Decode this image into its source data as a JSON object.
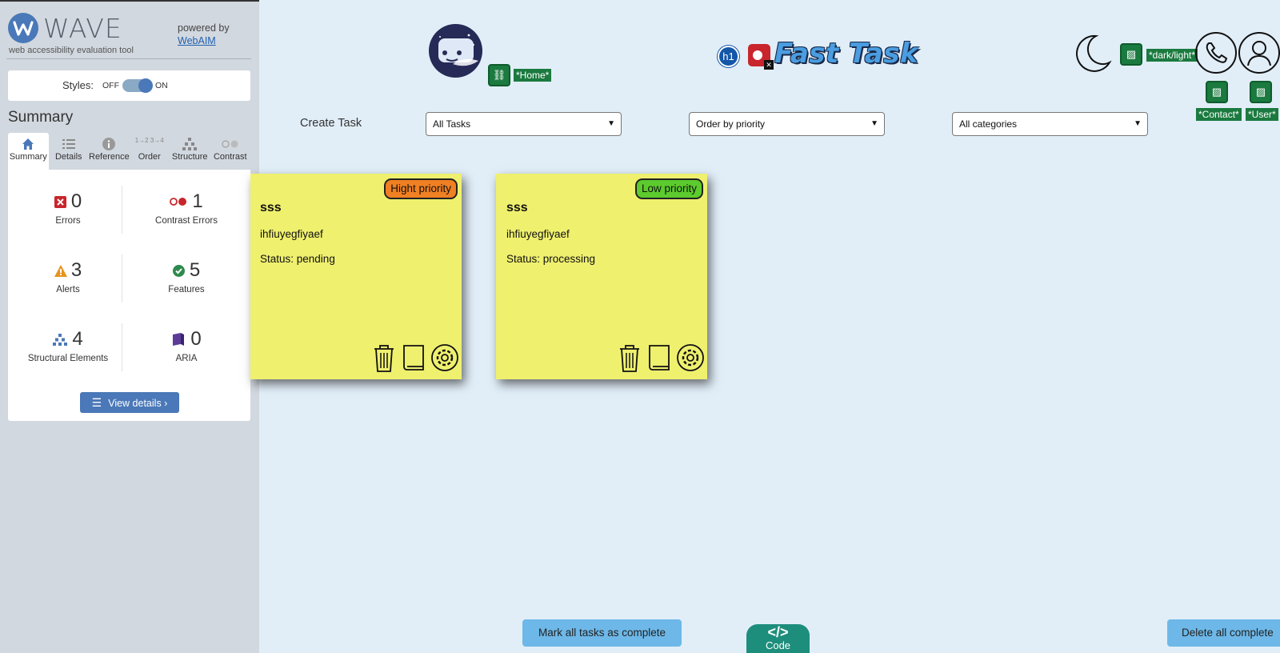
{
  "wave": {
    "brand": "WAVE",
    "subtitle": "web accessibility evaluation tool",
    "powered_by": "powered by",
    "powered_link": "WebAIM",
    "styles_label": "Styles:",
    "styles_off": "OFF",
    "styles_on": "ON",
    "summary_title": "Summary",
    "tabs": [
      {
        "label": "Summary",
        "icon": "home-icon"
      },
      {
        "label": "Details",
        "icon": "list-icon"
      },
      {
        "label": "Reference",
        "icon": "info-icon"
      },
      {
        "label": "Order",
        "icon": "order-icon"
      },
      {
        "label": "Structure",
        "icon": "structure-icon"
      },
      {
        "label": "Contrast",
        "icon": "contrast-icon"
      }
    ],
    "order_glyph": "1→2 3→4",
    "stats": {
      "errors": {
        "value": "0",
        "label": "Errors"
      },
      "contrast_errors": {
        "value": "1",
        "label": "Contrast Errors"
      },
      "alerts": {
        "value": "3",
        "label": "Alerts"
      },
      "features": {
        "value": "5",
        "label": "Features"
      },
      "structural": {
        "value": "4",
        "label": "Structural Elements"
      },
      "aria": {
        "value": "0",
        "label": "ARIA"
      }
    },
    "view_details": "View details ›"
  },
  "header": {
    "home_tag": "*Home*",
    "h1_badge": "h1",
    "app_title": "Fast Task",
    "darklight_tag": "*dark/light*",
    "contact_tag": "*Contact*",
    "user_tag": "*User*"
  },
  "toolbar": {
    "create_task": "Create Task",
    "filter_tasks": "All Tasks",
    "order": "Order by priority",
    "categories": "All categories"
  },
  "tasks": [
    {
      "priority": "Hight priority",
      "priority_color": "#f08022",
      "title": "sss",
      "description": "ihfiuyegfiyaef",
      "status": "Status: pending"
    },
    {
      "priority": "Low priority",
      "priority_color": "#5ccb2d",
      "title": "sss",
      "description": "ihfiuyegfiyaef",
      "status": "Status: processing"
    }
  ],
  "footer": {
    "mark_all": "Mark all tasks as complete",
    "code_symbol": "</>",
    "code_label": "Code",
    "delete_all": "Delete all complete"
  },
  "colors": {
    "page_bg": "#e1eef8",
    "card_bg": "#eff06e",
    "button_blue": "#6db8e8",
    "wave_accent": "#4a78b8"
  }
}
